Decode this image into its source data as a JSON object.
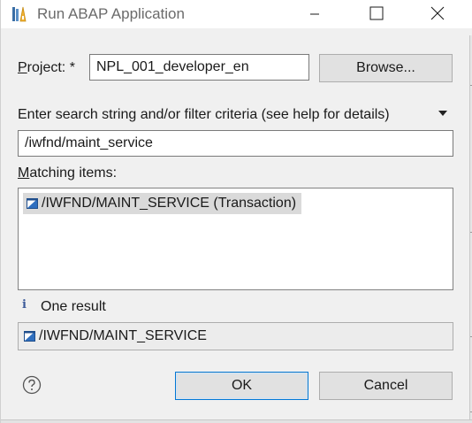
{
  "window": {
    "title": "Run ABAP Application"
  },
  "form": {
    "project_label_prefix": "P",
    "project_label_rest": "roject: *",
    "project_value": "NPL_001_developer_en",
    "browse_label": "Browse...",
    "search_label": "Enter search string and/or filter criteria (see help for details)",
    "search_value": "/iwfnd/maint_service",
    "matching_label_prefix": "M",
    "matching_label_rest": "atching items:"
  },
  "results": {
    "items": [
      {
        "label": "/IWFND/MAINT_SERVICE (Transaction)"
      }
    ],
    "status_text": "One result",
    "selected_detail": "/IWFND/MAINT_SERVICE"
  },
  "footer": {
    "ok_label": "OK",
    "cancel_label": "Cancel"
  },
  "icons": {
    "app": "abap-application-icon",
    "transaction": "transaction-icon",
    "info": "info-icon",
    "help": "help-icon"
  },
  "colors": {
    "default_button_border": "#0078d7",
    "selection_background": "#dadada",
    "info_icon": "#3c5a99"
  }
}
